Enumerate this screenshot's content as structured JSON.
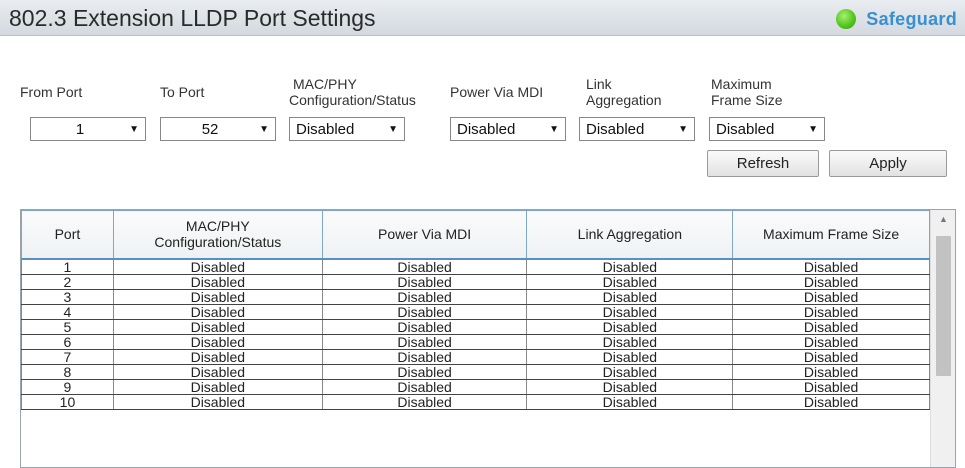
{
  "header": {
    "title": "802.3 Extension LLDP Port Settings",
    "brand_label": "Safeguard",
    "brand_color": "#3a8fd0",
    "status_dot_color": "#4fc319"
  },
  "form": {
    "from_port": {
      "label": "From Port",
      "value": "1"
    },
    "to_port": {
      "label": "To Port",
      "value": "52"
    },
    "mac_phy": {
      "label_line1": "MAC/PHY",
      "label_line2": "Configuration/Status",
      "value": "Disabled"
    },
    "power_via_mdi": {
      "label": "Power Via MDI",
      "value": "Disabled"
    },
    "link_aggregation": {
      "label_line1": "Link",
      "label_line2": "Aggregation",
      "value": "Disabled"
    },
    "max_frame_size": {
      "label_line1": "Maximum",
      "label_line2": "Frame Size",
      "value": "Disabled"
    },
    "refresh_label": "Refresh",
    "apply_label": "Apply",
    "dropdown_icon": "triangle-down"
  },
  "table": {
    "headers": {
      "port": "Port",
      "mac_phy_line1": "MAC/PHY",
      "mac_phy_line2": "Configuration/Status",
      "power_via_mdi": "Power Via MDI",
      "link_aggregation": "Link Aggregation",
      "max_frame_size": "Maximum Frame Size"
    },
    "rows": [
      [
        "1",
        "Disabled",
        "Disabled",
        "Disabled",
        "Disabled"
      ],
      [
        "2",
        "Disabled",
        "Disabled",
        "Disabled",
        "Disabled"
      ],
      [
        "3",
        "Disabled",
        "Disabled",
        "Disabled",
        "Disabled"
      ],
      [
        "4",
        "Disabled",
        "Disabled",
        "Disabled",
        "Disabled"
      ],
      [
        "5",
        "Disabled",
        "Disabled",
        "Disabled",
        "Disabled"
      ],
      [
        "6",
        "Disabled",
        "Disabled",
        "Disabled",
        "Disabled"
      ],
      [
        "7",
        "Disabled",
        "Disabled",
        "Disabled",
        "Disabled"
      ],
      [
        "8",
        "Disabled",
        "Disabled",
        "Disabled",
        "Disabled"
      ],
      [
        "9",
        "Disabled",
        "Disabled",
        "Disabled",
        "Disabled"
      ],
      [
        "10",
        "Disabled",
        "Disabled",
        "Disabled",
        "Disabled"
      ]
    ]
  }
}
